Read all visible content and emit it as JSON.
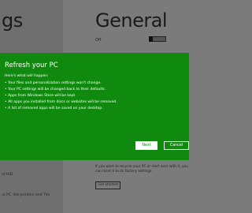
{
  "background": {
    "left_title": "gs",
    "right_title": "General",
    "toggle_label": "Off",
    "hint": "If you want to recycle your PC or start over with it, you can reset it to its factory settings.",
    "get_started_label": "Get started",
    "left_text_1": "rd HID",
    "left_text_2": "ur PC, like printers and TVs"
  },
  "dialog": {
    "title": "Refresh your PC",
    "intro": "Here's what will happen:",
    "items": [
      "• Your files and personalization settings won't change.",
      "• Your PC settings will be changed back to their defaults.",
      "• Apps from Windows Store will be kept.",
      "• All apps you installed from discs or websites will be removed.",
      "• A list of removed apps will be saved on your desktop."
    ],
    "next_label": "Next",
    "cancel_label": "Cancel"
  },
  "colors": {
    "dialog_green": "#0f8a0f",
    "dim_gray": "#7b7b7b"
  }
}
